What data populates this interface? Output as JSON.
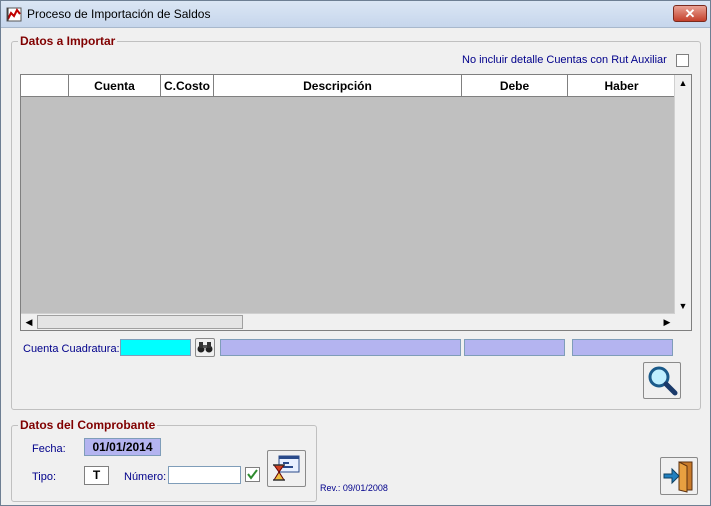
{
  "window": {
    "title": "Proceso de Importación de Saldos",
    "close_label": "✕"
  },
  "import_group": {
    "legend": "Datos a Importar",
    "exclude_label": "No incluir detalle Cuentas con Rut Auxiliar",
    "exclude_checked": false
  },
  "grid": {
    "columns": [
      "",
      "Cuenta",
      "C.Costo",
      "Descripción",
      "Debe",
      "Haber"
    ],
    "rows": []
  },
  "cuadratura": {
    "label": "Cuenta Cuadratura:",
    "value": "",
    "description": "",
    "debe": "",
    "haber": ""
  },
  "voucher_group": {
    "legend": "Datos del Comprobante",
    "fecha_label": "Fecha:",
    "fecha_value": "01/01/2014",
    "tipo_label": "Tipo:",
    "tipo_value": "T",
    "numero_label": "Número:",
    "numero_value": "",
    "numero_checked": true
  },
  "revision": "Rev.: 09/01/2008",
  "icons": {
    "app": "app-chart-icon",
    "binoculars": "binoculars-icon",
    "search": "magnifier-icon",
    "process": "hourglass-window-icon",
    "exit": "exit-door-icon"
  },
  "colors": {
    "legend": "#800000",
    "label_blue": "#00008b",
    "field_purple": "#b4b4f0",
    "field_cyan": "#00ffff",
    "grid_bg": "#c0c0c0"
  }
}
